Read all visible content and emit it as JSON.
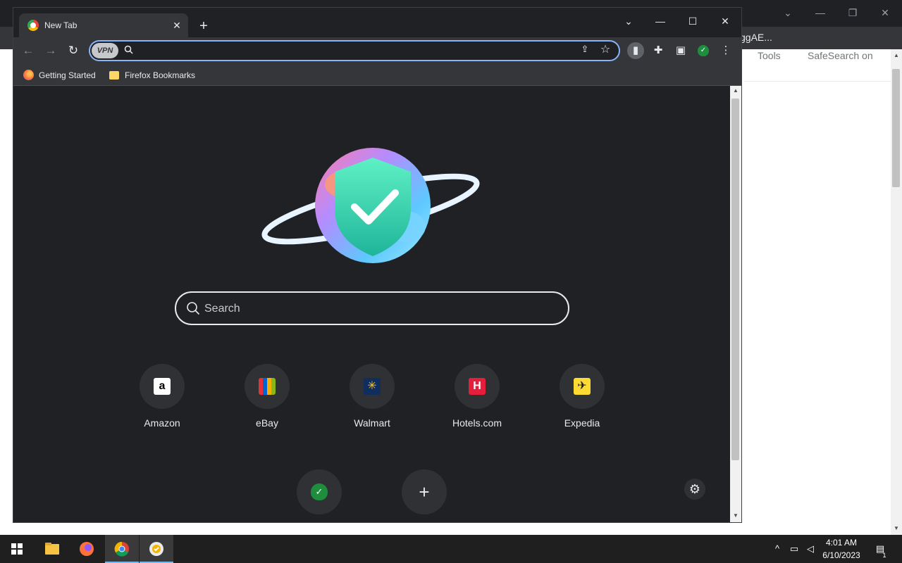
{
  "background_window": {
    "url_fragment": "ggAE...",
    "tools_label": "Tools",
    "safesearch_label": "SafeSearch on"
  },
  "tab": {
    "title": "New Tab"
  },
  "omnibox": {
    "vpn_badge": "VPN",
    "value": ""
  },
  "bookmarks": [
    {
      "label": "Getting Started",
      "icon": "firefox-icon"
    },
    {
      "label": "Firefox Bookmarks",
      "icon": "folder-icon"
    }
  ],
  "search": {
    "placeholder": "Search"
  },
  "shortcuts": [
    {
      "label": "Amazon",
      "icon": "amazon-icon",
      "logo_text": "a",
      "bg": "#ffffff",
      "fg": "#000000"
    },
    {
      "label": "eBay",
      "icon": "ebay-icon",
      "logo_text": "",
      "bg": "#3665f3",
      "fg": "#ffffff"
    },
    {
      "label": "Walmart",
      "icon": "walmart-icon",
      "logo_text": "✳",
      "bg": "#0f2e5e",
      "fg": "#ffc220"
    },
    {
      "label": "Hotels.com",
      "icon": "hotels-icon",
      "logo_text": "H",
      "bg": "#e41f3c",
      "fg": "#ffffff"
    },
    {
      "label": "Expedia",
      "icon": "expedia-icon",
      "logo_text": "✈",
      "bg": "#fddb32",
      "fg": "#191e3b"
    }
  ],
  "taskbar": {
    "time": "4:01 AM",
    "date": "6/10/2023",
    "notification_count": "1"
  },
  "colors": {
    "accent": "#8ab4f8",
    "surface": "#202124",
    "toolbar": "#35363a",
    "shortcut_bg": "#303134",
    "vpn_green": "#1e8e3e"
  }
}
